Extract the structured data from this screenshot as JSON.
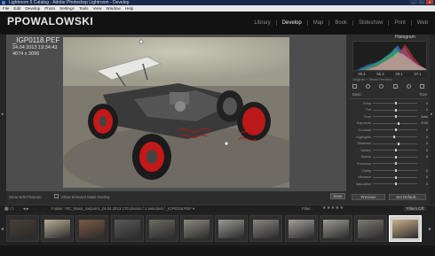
{
  "window": {
    "title": "Lightroom 5 Catalog - Adobe Photoshop Lightroom - Develop",
    "controls": [
      "–",
      "□",
      "✕"
    ]
  },
  "menu": [
    "File",
    "Edit",
    "Develop",
    "Photo",
    "Settings",
    "Tools",
    "View",
    "Window",
    "Help"
  ],
  "identity_plate": "PPOWALOWSKI",
  "modules": [
    {
      "label": "Library",
      "active": false
    },
    {
      "label": "Develop",
      "active": true
    },
    {
      "label": "Map",
      "active": false
    },
    {
      "label": "Book",
      "active": false
    },
    {
      "label": "Slideshow",
      "active": false
    },
    {
      "label": "Print",
      "active": false
    },
    {
      "label": "Web",
      "active": false
    }
  ],
  "photo_info": {
    "filename": "_IGP0118.PEF",
    "datetime": "24.04.2013 19:34:43",
    "dimensions": "4674 x 3096"
  },
  "right_panel": {
    "histogram_title": "Histogram",
    "hist_values": [
      "25.4",
      "55.3",
      "29.1",
      "37.1"
    ],
    "original_label": "Original + Smart Preview",
    "wb_label": "Basic",
    "wb_value": "Raw",
    "sliders": [
      {
        "label": "Temp",
        "pos": 0.5,
        "val": "0"
      },
      {
        "label": "Tint",
        "pos": 0.5,
        "val": "0"
      },
      {
        "label": "Tone",
        "pos": 0.5,
        "val": "Auto"
      },
      {
        "label": "Exposure",
        "pos": 0.55,
        "val": "0.00"
      },
      {
        "label": "Contrast",
        "pos": 0.5,
        "val": "0"
      },
      {
        "label": "Highlights",
        "pos": 0.45,
        "val": "0"
      },
      {
        "label": "Shadows",
        "pos": 0.55,
        "val": "0"
      },
      {
        "label": "Whites",
        "pos": 0.5,
        "val": "0"
      },
      {
        "label": "Blacks",
        "pos": 0.5,
        "val": "0"
      },
      {
        "label": "Presence",
        "pos": 0.5,
        "val": ""
      },
      {
        "label": "Clarity",
        "pos": 0.5,
        "val": "0"
      },
      {
        "label": "Vibrance",
        "pos": 0.5,
        "val": "0"
      },
      {
        "label": "Saturation",
        "pos": 0.5,
        "val": "0"
      }
    ],
    "previous_button": "Previous",
    "reset_button": "Set Default..."
  },
  "toolbar": {
    "show_label": "Show Edit Pins:",
    "show_value": "Auto",
    "selected_mask": "Show Selected Mask Overlay",
    "done": "Done"
  },
  "filmstrip_bar": {
    "path": "Folder : RC_Mass_Setpoint_24.04.2013     170 photos / 1 selected / _IGP0118.PEF ▾",
    "filter_label": "Filter :",
    "stars": "★★★★★",
    "filter_off": "Filters Off"
  },
  "colors": {
    "accent_red": "#d61a1a",
    "panel_bg": "#2d2d2d",
    "title_bg": "#16294a"
  }
}
